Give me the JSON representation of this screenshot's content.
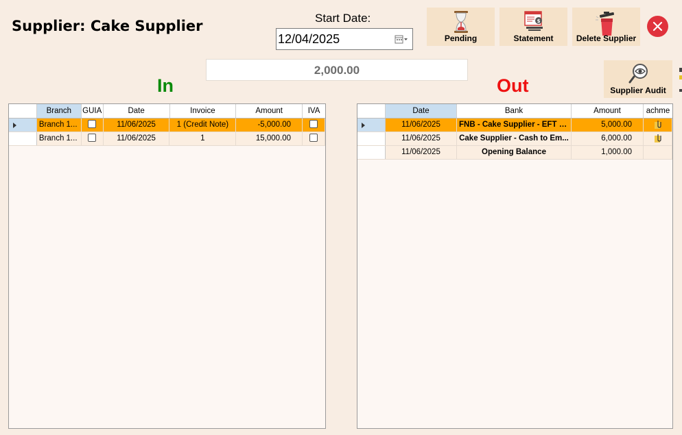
{
  "header": {
    "title": "Supplier: Cake Supplier",
    "start_date_label": "Start Date:",
    "start_date_value": "12/04/2025"
  },
  "toolbar": {
    "pending_label": "Pending",
    "statement_label": "Statement",
    "delete_label": "Delete Supplier",
    "audit_label": "Supplier Audit"
  },
  "balance": "2,000.00",
  "in_section": {
    "heading": "In",
    "heading_color": "#0a8a0a",
    "columns": [
      "Branch",
      "GUIA",
      "Date",
      "Invoice",
      "Amount",
      "IVA"
    ],
    "rows": [
      {
        "branch": "Branch 1...",
        "guia": false,
        "date": "11/06/2025",
        "invoice": "1 (Credit Note)",
        "amount": "-5,000.00",
        "iva": false,
        "highlight": true
      },
      {
        "branch": "Branch 1...",
        "guia": false,
        "date": "11/06/2025",
        "invoice": "1",
        "amount": "15,000.00",
        "iva": false,
        "highlight": false
      }
    ]
  },
  "out_section": {
    "heading": "Out",
    "heading_color": "#ee1111",
    "columns": [
      "Date",
      "Bank",
      "Amount",
      "achme"
    ],
    "rows": [
      {
        "date": "11/06/2025",
        "bank": "FNB - Cake Supplier - EFT P...",
        "amount": "5,000.00",
        "attachment": true,
        "highlight": true
      },
      {
        "date": "11/06/2025",
        "bank": "Cake Supplier - Cash to Em...",
        "amount": "6,000.00",
        "attachment": true,
        "highlight": false
      },
      {
        "date": "11/06/2025",
        "bank": "Opening Balance",
        "amount": "1,000.00",
        "attachment": false,
        "highlight": false
      }
    ]
  },
  "colors": {
    "background": "#f8ede3",
    "highlight_row": "#ffa500",
    "selected_header": "#c9def0",
    "close_button": "#e0323c"
  }
}
